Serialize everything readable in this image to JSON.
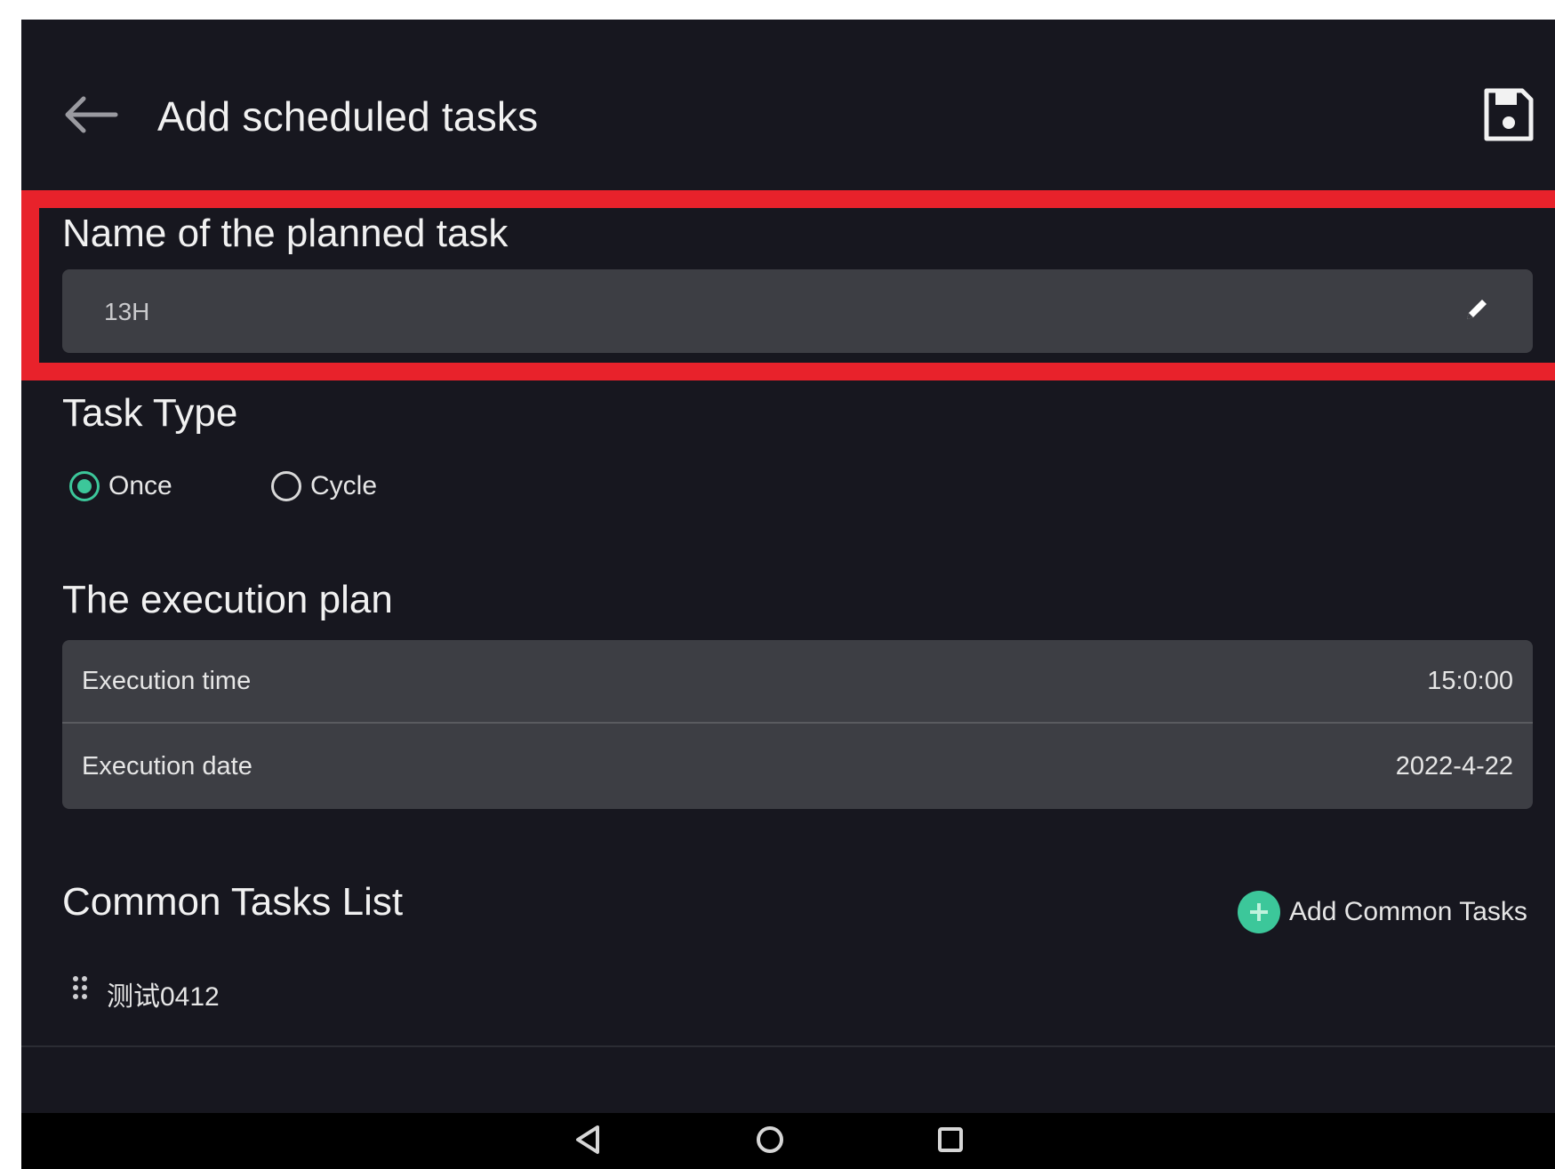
{
  "header": {
    "title": "Add scheduled tasks",
    "back_icon": "arrow-left-icon",
    "save_icon": "save-disk-icon"
  },
  "highlight_color": "#e8222b",
  "task_name": {
    "label": "Name of the planned task",
    "value": "13H",
    "edit_icon": "pencil-icon"
  },
  "task_type": {
    "label": "Task Type",
    "options": [
      {
        "label": "Once",
        "selected": true
      },
      {
        "label": "Cycle",
        "selected": false
      }
    ]
  },
  "execution_plan": {
    "label": "The execution plan",
    "rows": [
      {
        "label": "Execution time",
        "value": "15:0:00"
      },
      {
        "label": "Execution date",
        "value": "2022-4-22"
      }
    ]
  },
  "common_tasks": {
    "label": "Common Tasks List",
    "add_label": "Add Common Tasks",
    "add_icon": "plus-circle-icon",
    "items": [
      {
        "label": "测试0412",
        "icon": "drag-handle-icon"
      }
    ]
  },
  "system_nav": {
    "back_icon": "nav-back-icon",
    "home_icon": "nav-home-icon",
    "recent_icon": "nav-recent-icon"
  },
  "colors": {
    "background": "#17171f",
    "card": "#3d3e44",
    "accent": "#3cc79a",
    "text": "#f1f1f1"
  }
}
